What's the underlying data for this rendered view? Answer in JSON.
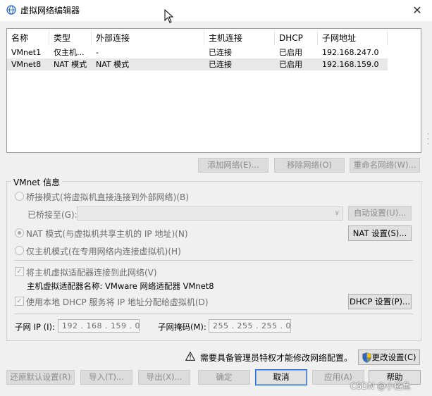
{
  "window": {
    "title": "虚拟网络编辑器",
    "close_glyph": "✕"
  },
  "table": {
    "headers": [
      "名称",
      "类型",
      "外部连接",
      "主机连接",
      "DHCP",
      "子网地址"
    ],
    "rows": [
      [
        "VMnet1",
        "仅主机...",
        "-",
        "已连接",
        "已启用",
        "192.168.247.0"
      ],
      [
        "VMnet8",
        "NAT 模式",
        "NAT 模式",
        "已连接",
        "已启用",
        "192.168.159.0"
      ]
    ]
  },
  "table_buttons": {
    "add": "添加网络(E)...",
    "remove": "移除网络(O)",
    "rename": "重命名网络(W)..."
  },
  "vmnet_info": {
    "group_label": "VMnet 信息",
    "bridge_radio": "桥接模式(将虚拟机直接连接到外部网络)(B)",
    "bridged_to_label": "已桥接至(G):",
    "bridged_to_value": "",
    "auto_settings": "自动设置(U)...",
    "nat_radio": "NAT 模式(与虚拟机共享主机的 IP 地址)(N)",
    "nat_settings": "NAT 设置(S)...",
    "host_only_radio": "仅主机模式(在专用网络内连接虚拟机)(H)",
    "connect_adapter_chk": "将主机虚拟适配器连接到此网络(V)",
    "adapter_name_label": "主机虚拟适配器名称: VMware 网络适配器 VMnet8",
    "dhcp_chk": "使用本地 DHCP 服务将 IP 地址分配给虚拟机(D)",
    "dhcp_settings": "DHCP 设置(P)...",
    "subnet_ip_label": "子网 IP (I):",
    "subnet_ip_value": "192 . 168 . 159 . 0",
    "subnet_mask_label": "子网掩码(M):",
    "subnet_mask_value": "255 . 255 . 255 . 0"
  },
  "admin": {
    "warning": "需要具备管理员特权才能修改网络配置。",
    "change_settings": "更改设置(C)"
  },
  "footer_buttons": {
    "restore_defaults": "还原默认设置(R)",
    "import": "导入(T)...",
    "export": "导出(X)...",
    "ok": "确定",
    "cancel": "取消",
    "apply": "应用(A)",
    "help": "帮助"
  },
  "watermark": "CSDN @小俗鱼",
  "colors": {
    "accent": "#2b6ed0",
    "disabled_text": "#8c8c8c",
    "selected_row": "#e8e8e8"
  }
}
